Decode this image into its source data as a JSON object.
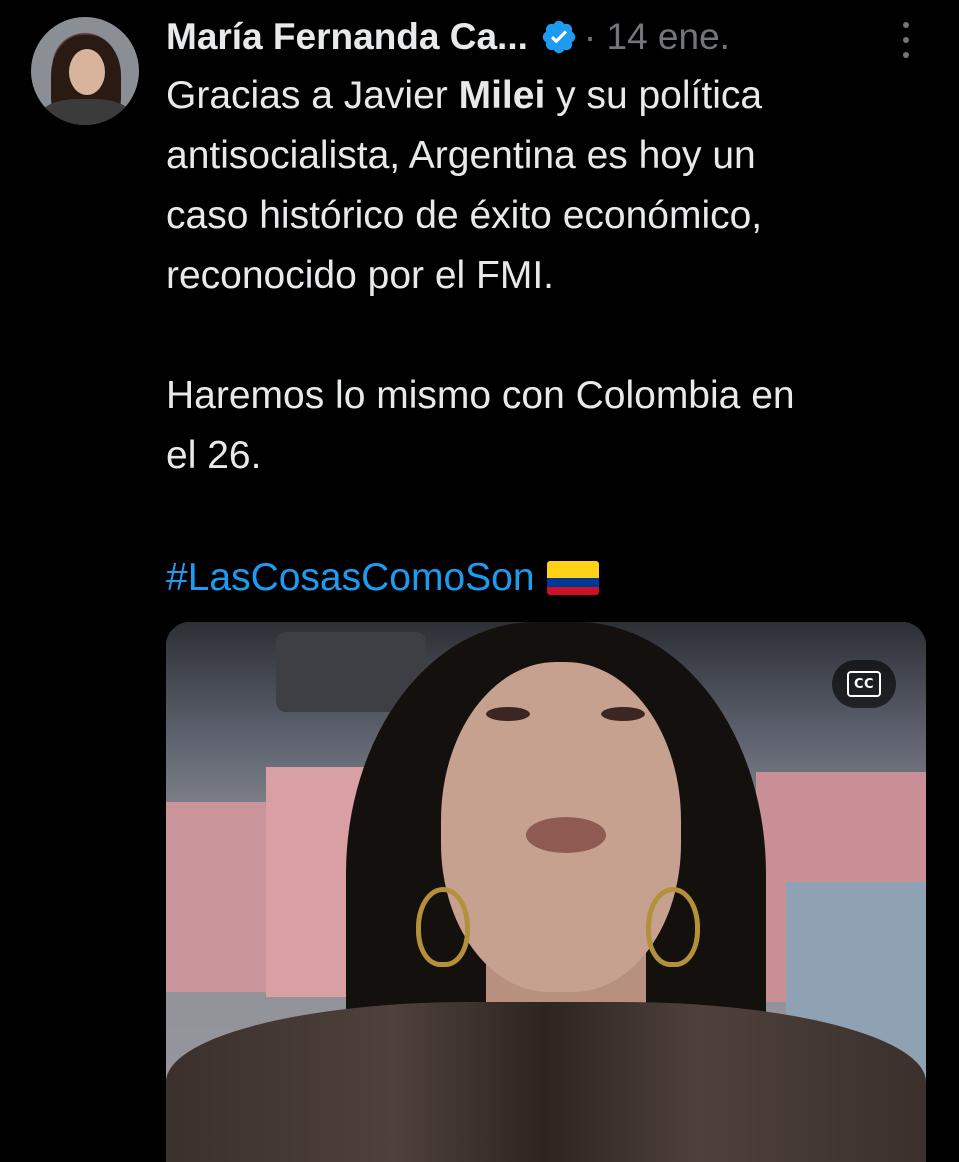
{
  "author": {
    "display_name": "María Fernanda Ca...",
    "verified": true,
    "date_separator": "·",
    "date": "14 ene."
  },
  "tweet": {
    "line1_before": "Gracias a Javier ",
    "line1_bold": "Milei",
    "line1_after": " y su política",
    "line2": "antisocialista, Argentina es hoy un",
    "line3": "caso histórico de éxito económico,",
    "line4": "reconocido por el FMI.",
    "line5": "Haremos lo mismo con Colombia en",
    "line6": "el 26.",
    "hashtag": "#LasCosasComoSon",
    "emoji": "colombia-flag"
  },
  "media": {
    "type": "video",
    "captions_label": "CC"
  },
  "colors": {
    "background": "#000000",
    "text": "#e7e9ea",
    "muted": "#71767b",
    "link": "#1d9bf0",
    "verified_badge": "#1d9bf0"
  }
}
